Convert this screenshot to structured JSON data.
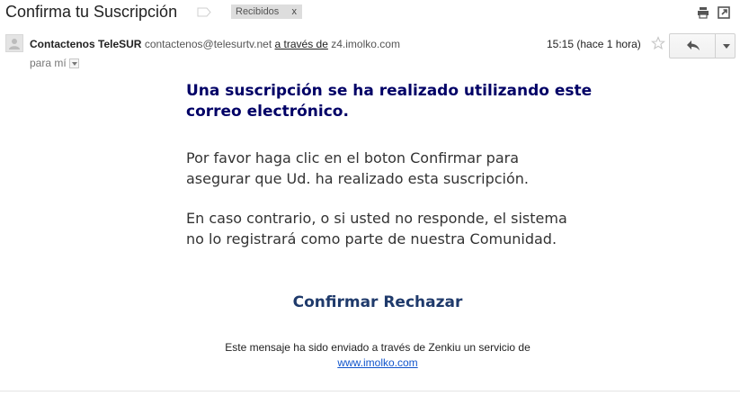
{
  "thread": {
    "subject": "Confirma tu Suscripción",
    "label": "Recibidos",
    "label_remove": "x"
  },
  "message": {
    "sender_name": "Contactenos TeleSUR",
    "sender_email": "contactenos@telesurtv.net",
    "via_text": "a través de",
    "via_domain": "z4.imolko.com",
    "recipient": "para mí",
    "time": "15:15 (hace 1 hora)"
  },
  "body": {
    "heading": "Una suscripción se ha realizado utilizando este correo electrónico.",
    "paragraph1": "Por favor haga clic en el boton Confirmar para asegurar que Ud. ha realizado esta suscripción.",
    "paragraph2": "En caso contrario, o si usted no responde, el sistema no lo registrará como parte de nuestra Comunidad.",
    "confirm_label": "Confirmar",
    "reject_label": "Rechazar",
    "footer_text": "Este mensaje ha sido enviado a través de Zenkiu un servicio de",
    "footer_link": "www.imolko.com"
  },
  "icons": {
    "importance": "importance-marker-icon",
    "print": "print-icon",
    "new_window": "new-window-icon",
    "star": "star-icon",
    "reply": "reply-icon",
    "more": "chevron-down-icon",
    "avatar": "avatar-icon"
  },
  "colors": {
    "heading": "#000066",
    "actions": "#1f3a6b",
    "link": "#1155cc",
    "label_chip": "#dddddd"
  }
}
